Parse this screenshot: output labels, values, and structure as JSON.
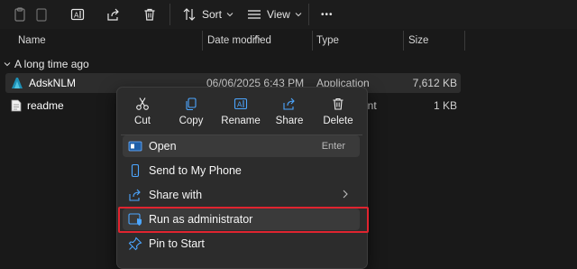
{
  "toolbar": {
    "sort_label": "Sort",
    "view_label": "View",
    "more_label": "•••"
  },
  "columns": {
    "name": "Name",
    "date_modified": "Date modified",
    "type": "Type",
    "size": "Size"
  },
  "group": {
    "label": "A long time ago"
  },
  "files": [
    {
      "name": "AdskNLM",
      "date": "06/06/2025 6:43 PM",
      "type": "Application",
      "size": "7,612 KB",
      "icon": "app-icon"
    },
    {
      "name": "readme",
      "date": "",
      "type": "ent",
      "size": "1 KB",
      "icon": "document-icon"
    }
  ],
  "context_menu": {
    "quick_actions": [
      {
        "label": "Cut",
        "icon": "scissors-icon"
      },
      {
        "label": "Copy",
        "icon": "copy-icon"
      },
      {
        "label": "Rename",
        "icon": "rename-icon"
      },
      {
        "label": "Share",
        "icon": "share-icon"
      },
      {
        "label": "Delete",
        "icon": "trash-icon"
      }
    ],
    "items": [
      {
        "label": "Open",
        "shortcut": "Enter",
        "icon": "open-app-icon"
      },
      {
        "label": "Send to My Phone",
        "icon": "phone-icon"
      },
      {
        "label": "Share with",
        "icon": "share-with-icon"
      },
      {
        "label": "Run as administrator",
        "icon": "admin-shield-icon"
      },
      {
        "label": "Pin to Start",
        "icon": "pin-icon"
      }
    ]
  },
  "colors": {
    "background": "#191919",
    "menu_background": "#2c2c2c",
    "highlight_border": "#e0242f",
    "accent_blue": "#4ca6ff"
  }
}
